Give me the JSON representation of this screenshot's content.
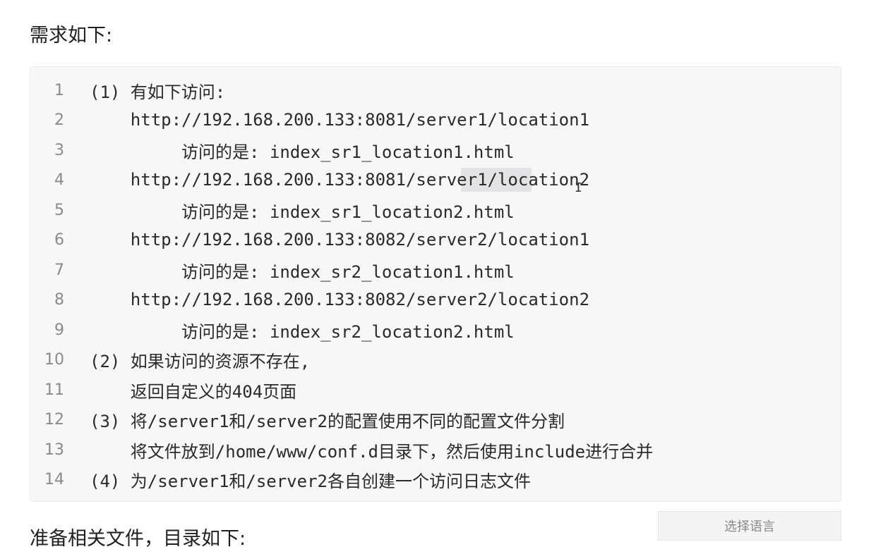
{
  "headings": {
    "requirements": "需求如下:",
    "prepare": "准备相关文件，目录如下:"
  },
  "code": {
    "lines": [
      {
        "num": "1",
        "text": "(1) 有如下访问:"
      },
      {
        "num": "2",
        "text": "    http://192.168.200.133:8081/server1/location1"
      },
      {
        "num": "3",
        "text": "         访问的是: index_sr1_location1.html"
      },
      {
        "num": "4",
        "text": "    http://192.168.200.133:8081/server1/location2"
      },
      {
        "num": "5",
        "text": "         访问的是: index_sr1_location2.html"
      },
      {
        "num": "6",
        "text": "    http://192.168.200.133:8082/server2/location1"
      },
      {
        "num": "7",
        "text": "         访问的是: index_sr2_location1.html"
      },
      {
        "num": "8",
        "text": "    http://192.168.200.133:8082/server2/location2"
      },
      {
        "num": "9",
        "text": "         访问的是: index_sr2_location2.html"
      },
      {
        "num": "10",
        "text": "(2) 如果访问的资源不存在,"
      },
      {
        "num": "11",
        "text": "    返回自定义的404页面"
      },
      {
        "num": "12",
        "text": "(3) 将/server1和/server2的配置使用不同的配置文件分割"
      },
      {
        "num": "13",
        "text": "    将文件放到/home/www/conf.d目录下，然后使用include进行合并"
      },
      {
        "num": "14",
        "text": "(4) 为/server1和/server2各自创建一个访问日志文件"
      }
    ]
  },
  "language_button": {
    "label": "选择语言"
  }
}
